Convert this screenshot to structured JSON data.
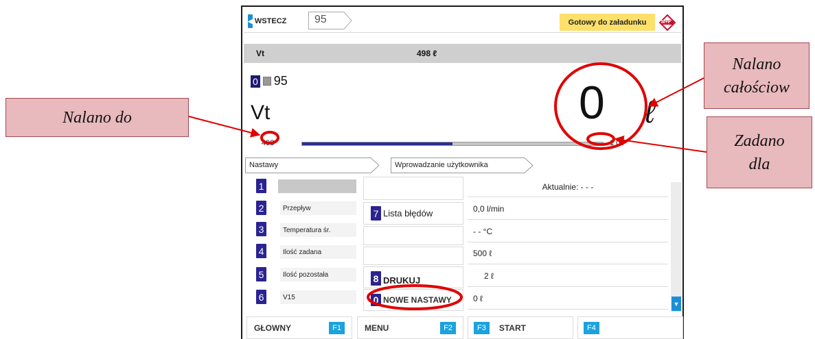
{
  "header": {
    "back_label": "WSTECZ",
    "product_number": "95",
    "status": "Gotowy do załadunku",
    "logo_text": "M+F"
  },
  "summary": {
    "label": "Vt",
    "value": "498 ℓ"
  },
  "main": {
    "index": "0",
    "product": "95",
    "title": "Vt",
    "total": "0",
    "total_unit": "ℓ",
    "filled_to": "498",
    "preset_for": "1 00",
    "progress": 0.5
  },
  "breadcrumb": [
    "Nastawy",
    "Wprowadzanie użytkownika"
  ],
  "rows": [
    {
      "num": "1",
      "label": "",
      "value": "Aktualnie: - - -"
    },
    {
      "num": "2",
      "label": "Przepływ",
      "value": "0,0 l/min"
    },
    {
      "num": "3",
      "label": "Temperatura śr.",
      "value": "- - °C"
    },
    {
      "num": "4",
      "label": "Ilość zadana",
      "value": "500 ℓ"
    },
    {
      "num": "5",
      "label": "Ilość pozostała",
      "value": "2 ℓ"
    },
    {
      "num": "6",
      "label": "V15",
      "value": "0 ℓ"
    }
  ],
  "buttons": {
    "errors": {
      "num": "7",
      "label": "Lista błędów"
    },
    "print": {
      "num": "8",
      "label": "DRUKUJ"
    },
    "new_settings": {
      "num": "0",
      "label": "NOWE NASTAWY"
    }
  },
  "fkeys": [
    {
      "label": "GŁOWNY",
      "key": "F1"
    },
    {
      "label": "MENU",
      "key": "F2"
    },
    {
      "label": "START",
      "key": "F3"
    },
    {
      "label": "",
      "key": "F4"
    }
  ],
  "callouts": {
    "filled_to": "Nalano do",
    "total_filled_1": "Nalano",
    "total_filled_2": "całościow",
    "preset_for_1": "Zadano",
    "preset_for_2": "dla"
  },
  "colors": {
    "accent": "#1a8fd8",
    "badge": "#2b2391",
    "highlight": "#e00000",
    "callout": "#e8b9bd"
  }
}
